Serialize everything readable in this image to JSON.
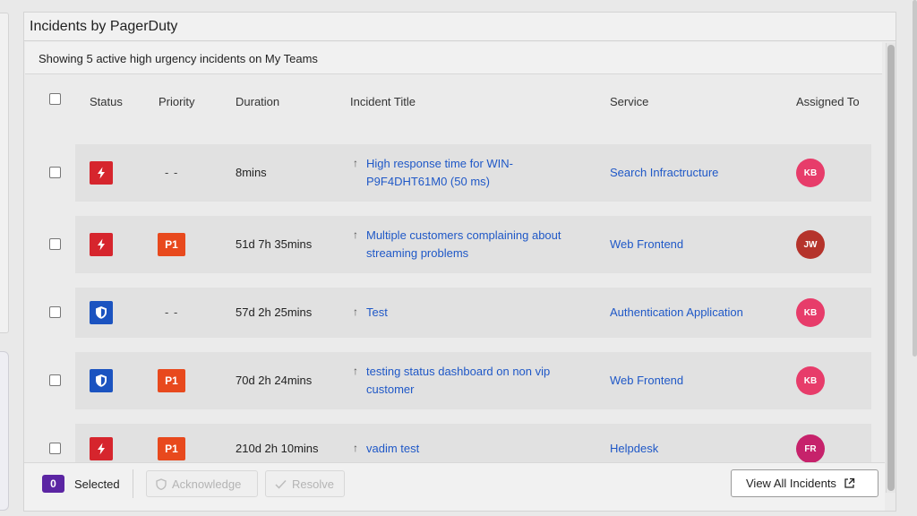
{
  "widget": {
    "title": "Incidents by PagerDuty",
    "summary": "Showing 5 active high urgency incidents on My Teams"
  },
  "table": {
    "columns": {
      "status": "Status",
      "priority": "Priority",
      "duration": "Duration",
      "title": "Incident Title",
      "service": "Service",
      "assigned": "Assigned To"
    },
    "rows": [
      {
        "status": "triggered",
        "priority": "- -",
        "duration": "8mins",
        "title": "High response time for WIN-P9F4DHT61M0 (50 ms)",
        "service": "Search Infractructure",
        "assignee": "KB",
        "assignee_color": "#e73c6a"
      },
      {
        "status": "triggered",
        "priority": "P1",
        "duration": "51d 7h 35mins",
        "title": "Multiple customers complaining about streaming problems",
        "service": "Web Frontend",
        "assignee": "JW",
        "assignee_color": "#b5332b"
      },
      {
        "status": "acknowledged",
        "priority": "- -",
        "duration": "57d 2h 25mins",
        "title": "Test",
        "service": "Authentication Application",
        "assignee": "KB",
        "assignee_color": "#e73c6a"
      },
      {
        "status": "acknowledged",
        "priority": "P1",
        "duration": "70d 2h 24mins",
        "title": "testing status dashboard on non vip customer",
        "service": "Web Frontend",
        "assignee": "KB",
        "assignee_color": "#e73c6a"
      },
      {
        "status": "triggered",
        "priority": "P1",
        "duration": "210d 2h 10mins",
        "title": "vadim test",
        "service": "Helpdesk",
        "assignee": "FR",
        "assignee_color": "#c6226b"
      }
    ],
    "arrow_glyph": "↑"
  },
  "footer": {
    "selected_count": "0",
    "selected_label": "Selected",
    "acknowledge_label": "Acknowledge",
    "resolve_label": "Resolve",
    "view_all_label": "View All Incidents"
  },
  "colors": {
    "triggered": "#d6252d",
    "acknowledged": "#1b53c0",
    "priority_p1": "#e8491d",
    "link": "#1f58c7",
    "selected_badge": "#5b25a3"
  }
}
